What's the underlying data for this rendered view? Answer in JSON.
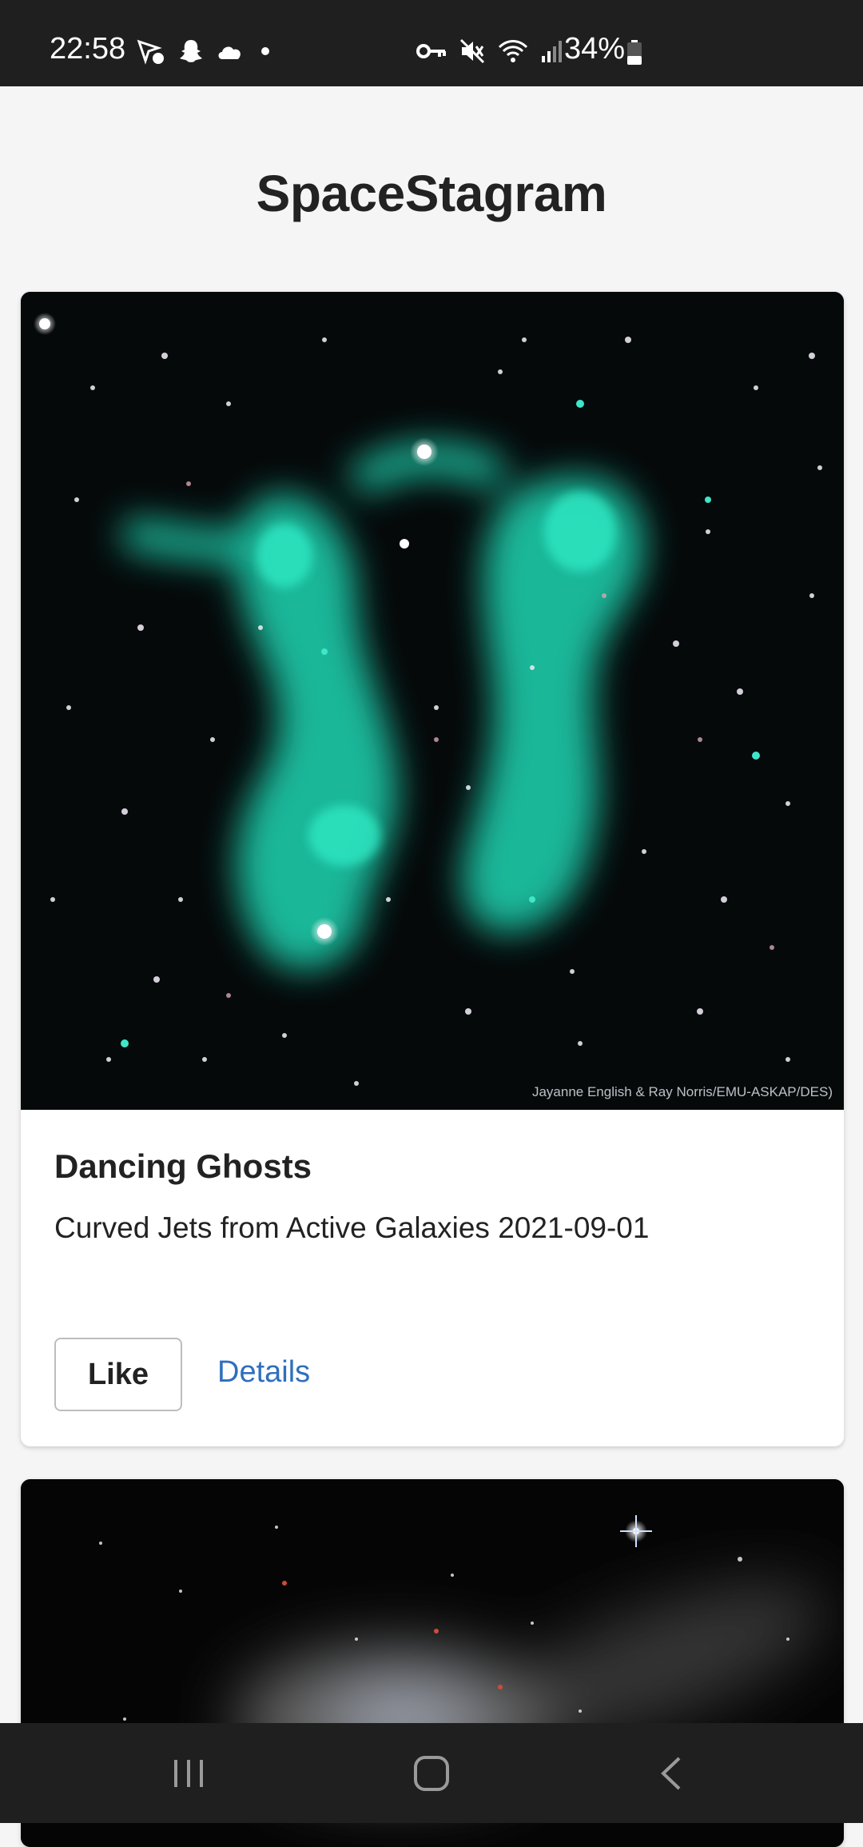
{
  "status_bar": {
    "time": "22:58",
    "battery_percent": "34%",
    "left_icons": [
      "pin-check-icon",
      "snapchat-icon",
      "cloud-icon",
      "dot-icon"
    ],
    "right_icons": [
      "vpn-key-icon",
      "mute-icon",
      "wifi-icon",
      "signal-icon",
      "battery-icon"
    ]
  },
  "app": {
    "title": "SpaceStagram"
  },
  "posts": [
    {
      "image_credit": "Jayanne English & Ray Norris/EMU-ASKAP/DES)",
      "title": "Dancing Ghosts",
      "subtitle": "Curved Jets from Active Galaxies 2021-09-01",
      "like_label": "Like",
      "details_label": "Details"
    }
  ],
  "nav_bar": {
    "buttons": [
      "recents-icon",
      "home-icon",
      "back-icon"
    ]
  },
  "colors": {
    "link": "#2f6fbd",
    "background": "#f5f5f5",
    "status_bar": "#1f1f1f"
  }
}
